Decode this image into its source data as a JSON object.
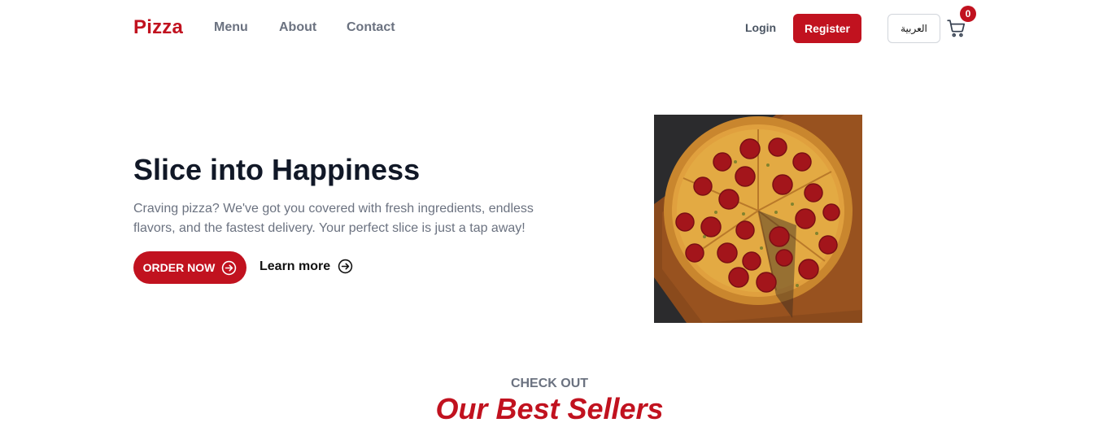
{
  "header": {
    "logo": "Pizza",
    "nav": {
      "menu": "Menu",
      "about": "About",
      "contact": "Contact"
    },
    "login": "Login",
    "register": "Register",
    "language": "العربية",
    "cart_count": "0"
  },
  "hero": {
    "title": "Slice into Happiness",
    "description": "Craving pizza? We've got you covered with fresh ingredients, endless flavors, and the fastest delivery. Your perfect slice is just a tap away!",
    "order_label": "ORDER NOW",
    "learn_more_label": "Learn more"
  },
  "best_sellers": {
    "kicker": "CHECK OUT",
    "title": "Our Best Sellers"
  },
  "colors": {
    "brand_red": "#c1121f",
    "muted_text": "#6b7280"
  },
  "icons": {
    "cart": "cart-icon",
    "order_arrow": "arrow-right-circle-icon",
    "learn_arrow": "arrow-right-circle-icon"
  }
}
